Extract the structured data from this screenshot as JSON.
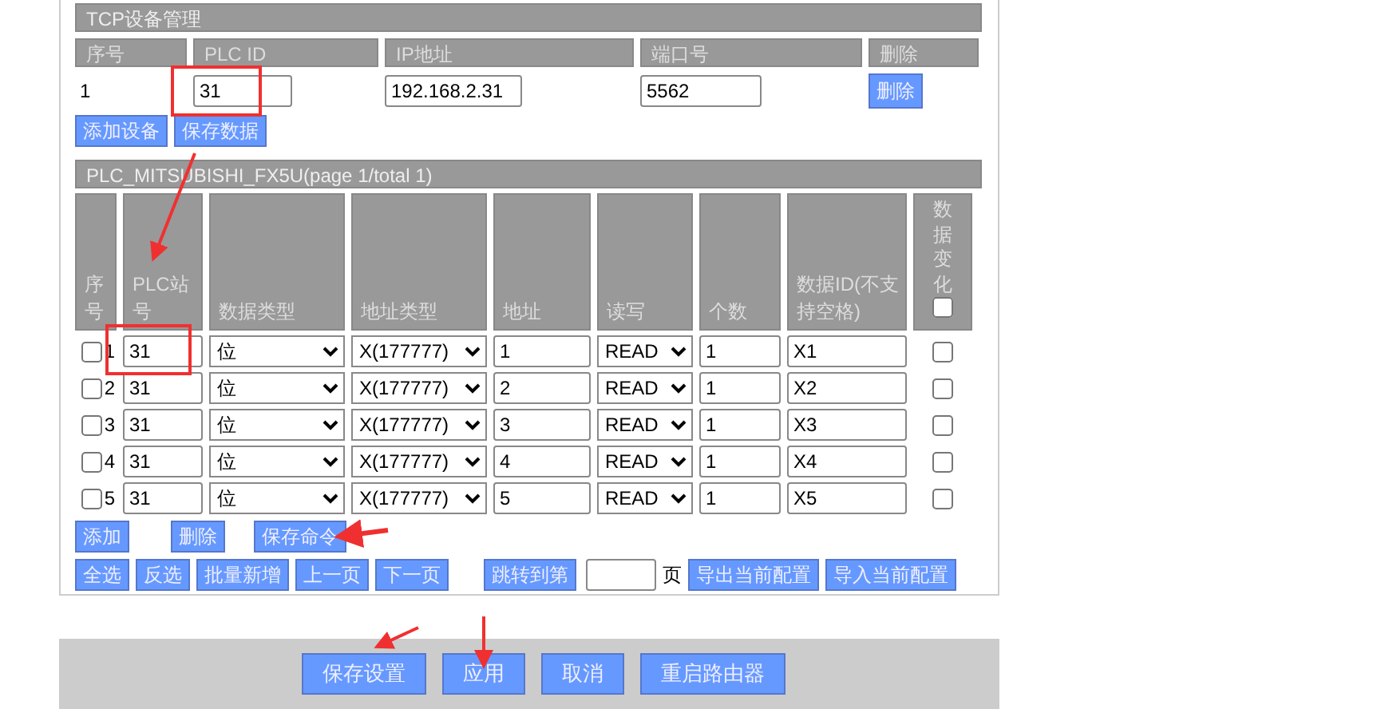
{
  "tcp_section": {
    "title": "TCP设备管理",
    "columns": [
      "序号",
      "PLC ID",
      "IP地址",
      "端口号",
      "删除"
    ],
    "rows": [
      {
        "index": "1",
        "plc_id": "31",
        "ip": "192.168.2.31",
        "port": "5562",
        "delete": "删除"
      }
    ],
    "buttons": [
      "添加设备",
      "保存数据"
    ]
  },
  "plc_section": {
    "title": "PLC_MITSUBISHI_FX5U(page 1/total 1)",
    "columns": [
      "序号",
      "PLC站号",
      "数据类型",
      "地址类型",
      "地址",
      "读写",
      "个数",
      "数据ID(不支持空格)",
      "数据变化"
    ],
    "change_all_checked": false,
    "rows": [
      {
        "checked": false,
        "index": "1",
        "station": "31",
        "data_type": "位",
        "address_type": "X(177777)",
        "address": "1",
        "rw": "READ",
        "count": "1",
        "data_id": "X1",
        "change": false
      },
      {
        "checked": false,
        "index": "2",
        "station": "31",
        "data_type": "位",
        "address_type": "X(177777)",
        "address": "2",
        "rw": "READ",
        "count": "1",
        "data_id": "X2",
        "change": false
      },
      {
        "checked": false,
        "index": "3",
        "station": "31",
        "data_type": "位",
        "address_type": "X(177777)",
        "address": "3",
        "rw": "READ",
        "count": "1",
        "data_id": "X3",
        "change": false
      },
      {
        "checked": false,
        "index": "4",
        "station": "31",
        "data_type": "位",
        "address_type": "X(177777)",
        "address": "4",
        "rw": "READ",
        "count": "1",
        "data_id": "X4",
        "change": false
      },
      {
        "checked": false,
        "index": "5",
        "station": "31",
        "data_type": "位",
        "address_type": "X(177777)",
        "address": "5",
        "rw": "READ",
        "count": "1",
        "data_id": "X5",
        "change": false
      }
    ],
    "row_buttons": [
      "添加",
      "删除",
      "保存命令"
    ],
    "nav_buttons": [
      "全选",
      "反选",
      "批量新增",
      "上一页",
      "下一页"
    ],
    "jump_button": "跳转到第",
    "page_suffix": "页",
    "config_buttons": [
      "导出当前配置",
      "导入当前配置"
    ]
  },
  "footer_buttons": [
    "保存设置",
    "应用",
    "取消",
    "重启路由器"
  ]
}
